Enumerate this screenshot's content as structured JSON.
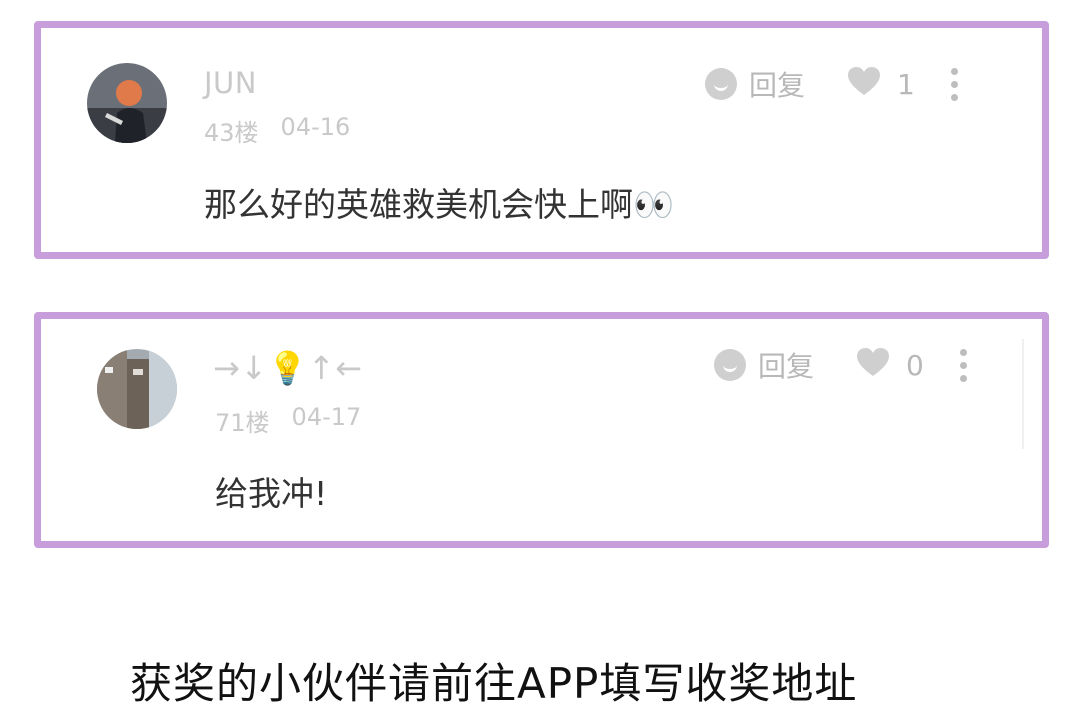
{
  "comments": [
    {
      "username": "JUN",
      "floor": "43楼",
      "date": "04-16",
      "text": "那么好的英雄救美机会快上啊👀",
      "reply_label": "回复",
      "like_count": "1"
    },
    {
      "username": "→↓💡↑←",
      "floor": "71楼",
      "date": "04-17",
      "text": "给我冲!",
      "reply_label": "回复",
      "like_count": "0"
    }
  ],
  "footer": {
    "text": "获奖的小伙伴请前往APP填写收奖地址"
  },
  "colors": {
    "card_border": "#c79ddb",
    "meta_text": "#c9c9c9",
    "body_text": "#333333"
  }
}
